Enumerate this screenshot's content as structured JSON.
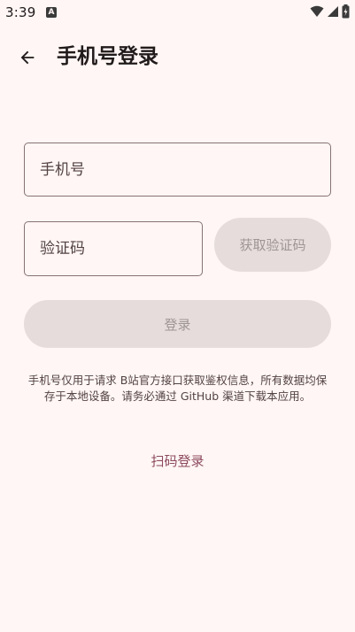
{
  "status_bar": {
    "time": "3:39",
    "notification_icon_letter": "A",
    "icons": [
      "wifi-icon",
      "signal-icon",
      "battery-icon"
    ]
  },
  "app_bar": {
    "back_icon": "arrow-left-icon",
    "title": "手机号登录"
  },
  "form": {
    "phone_placeholder": "手机号",
    "phone_value": "",
    "code_placeholder": "验证码",
    "code_value": "",
    "get_code_label": "获取验证码",
    "login_label": "登录"
  },
  "notice": "手机号仅用于请求 B站官方接口获取鉴权信息，所有数据均保存于本地设备。请务必通过 GitHub 渠道下载本应用。",
  "qr_login_label": "扫码登录",
  "colors": {
    "background": "#fff6f5",
    "outline": "#857373",
    "disabled_container": "#e5dcdb",
    "disabled_text": "#9e9595",
    "link": "#8c4a5e"
  }
}
